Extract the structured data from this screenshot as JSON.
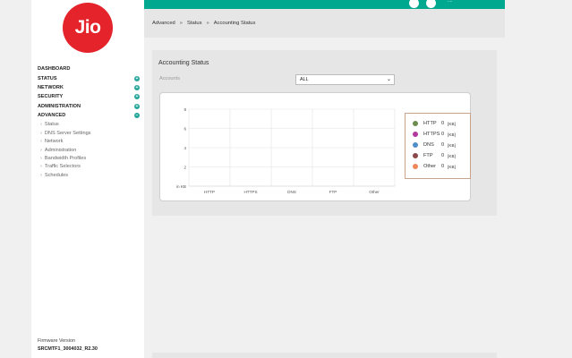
{
  "sidebar": {
    "logo_text": "Jio",
    "nav": [
      {
        "label": "DASHBOARD",
        "badge": ""
      },
      {
        "label": "STATUS",
        "badge": "+"
      },
      {
        "label": "NETWORK",
        "badge": "+"
      },
      {
        "label": "SECURITY",
        "badge": "+"
      },
      {
        "label": "ADMINISTRATION",
        "badge": "+"
      },
      {
        "label": "ADVANCED",
        "badge": "−"
      }
    ],
    "sub_items": [
      "Status",
      "DNS Server Settings",
      "Network",
      "Administration",
      "Bandwidth Profiles",
      "Traffic Selectors",
      "Schedules"
    ],
    "firmware_label": "Firmware Version",
    "firmware_value": "SRCMTF1_3004032_R2.30"
  },
  "topbar": {
    "text": "...."
  },
  "breadcrumb": {
    "items": [
      "Advanced",
      "Status",
      "Accounting Status"
    ],
    "separator": "»"
  },
  "panel": {
    "title": "Accounting Status",
    "accounts_label": "Accounts",
    "accounts_value": "ALL"
  },
  "legend": [
    {
      "name": "HTTP",
      "value": "0",
      "unit": "[KB]",
      "color": "#6b8e4e"
    },
    {
      "name": "HTTPS",
      "value": "0",
      "unit": "[KB]",
      "color": "#b23a9c"
    },
    {
      "name": "DNS",
      "value": "0",
      "unit": "[KB]",
      "color": "#4f8fc8"
    },
    {
      "name": "FTP",
      "value": "0",
      "unit": "[KB]",
      "color": "#8b4a4a"
    },
    {
      "name": "Other",
      "value": "0",
      "unit": "[KB]",
      "color": "#f0875a"
    }
  ],
  "chart_data": {
    "type": "bar",
    "categories": [
      "HTTP",
      "HTTPS",
      "DNS",
      "FTP",
      "Other"
    ],
    "values": [
      0,
      0,
      0,
      0,
      0
    ],
    "ylabel": "in KB",
    "yticks": [
      "0",
      "2",
      "4",
      "6",
      "8"
    ],
    "ylim": [
      0,
      8
    ]
  }
}
